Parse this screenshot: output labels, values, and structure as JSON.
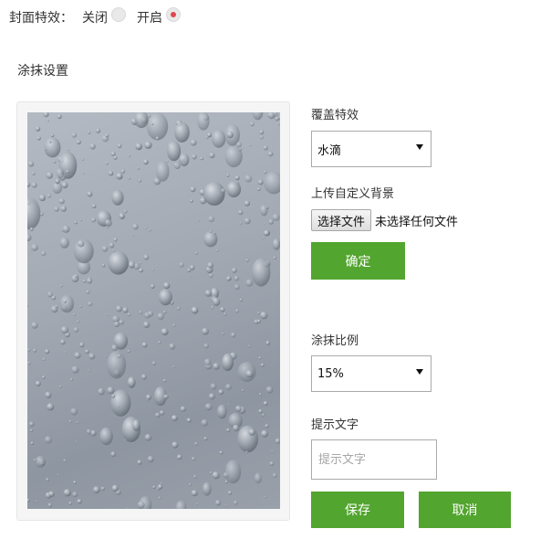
{
  "cover_effect": {
    "label": "封面特效：",
    "options": [
      {
        "label": "关闭",
        "checked": false
      },
      {
        "label": "开启",
        "checked": true
      }
    ],
    "radio_accent_color": "#e0474c"
  },
  "smear": {
    "section_title": "涂抹设置",
    "preview": {
      "description": "water droplets on glass"
    },
    "overlay_effect": {
      "label": "覆盖特效",
      "selected": "水滴"
    },
    "upload_background": {
      "label": "上传自定义背景",
      "choose_button": "选择文件",
      "no_file_text": "未选择任何文件"
    },
    "confirm_button": "确定",
    "smear_ratio": {
      "label": "涂抹比例",
      "selected": "15%"
    },
    "hint_text": {
      "label": "提示文字",
      "placeholder": "提示文字",
      "value": ""
    },
    "save_button": "保存",
    "cancel_button": "取消",
    "button_color": "#52a52e"
  }
}
